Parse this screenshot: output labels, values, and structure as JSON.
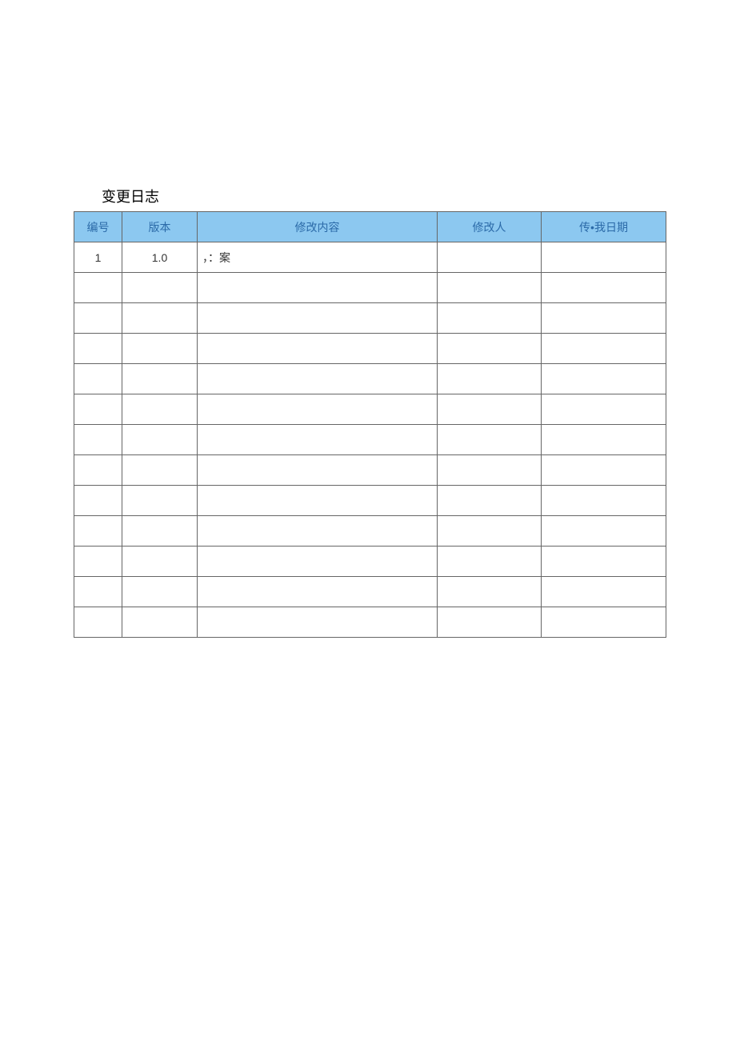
{
  "title": "变更日志",
  "headers": {
    "num": "编号",
    "version": "版本",
    "content": "修改内容",
    "modifier": "修改人",
    "date": "传•我日期"
  },
  "rows": [
    {
      "num": "1",
      "version": "1.0",
      "content": "，：案",
      "modifier": "",
      "date": ""
    },
    {
      "num": "",
      "version": "",
      "content": "",
      "modifier": "",
      "date": ""
    },
    {
      "num": "",
      "version": "",
      "content": "",
      "modifier": "",
      "date": ""
    },
    {
      "num": "",
      "version": "",
      "content": "",
      "modifier": "",
      "date": ""
    },
    {
      "num": "",
      "version": "",
      "content": "",
      "modifier": "",
      "date": ""
    },
    {
      "num": "",
      "version": "",
      "content": "",
      "modifier": "",
      "date": ""
    },
    {
      "num": "",
      "version": "",
      "content": "",
      "modifier": "",
      "date": ""
    },
    {
      "num": "",
      "version": "",
      "content": "",
      "modifier": "",
      "date": ""
    },
    {
      "num": "",
      "version": "",
      "content": "",
      "modifier": "",
      "date": ""
    },
    {
      "num": "",
      "version": "",
      "content": "",
      "modifier": "",
      "date": ""
    },
    {
      "num": "",
      "version": "",
      "content": "",
      "modifier": "",
      "date": ""
    },
    {
      "num": "",
      "version": "",
      "content": "",
      "modifier": "",
      "date": ""
    },
    {
      "num": "",
      "version": "",
      "content": "",
      "modifier": "",
      "date": ""
    }
  ]
}
